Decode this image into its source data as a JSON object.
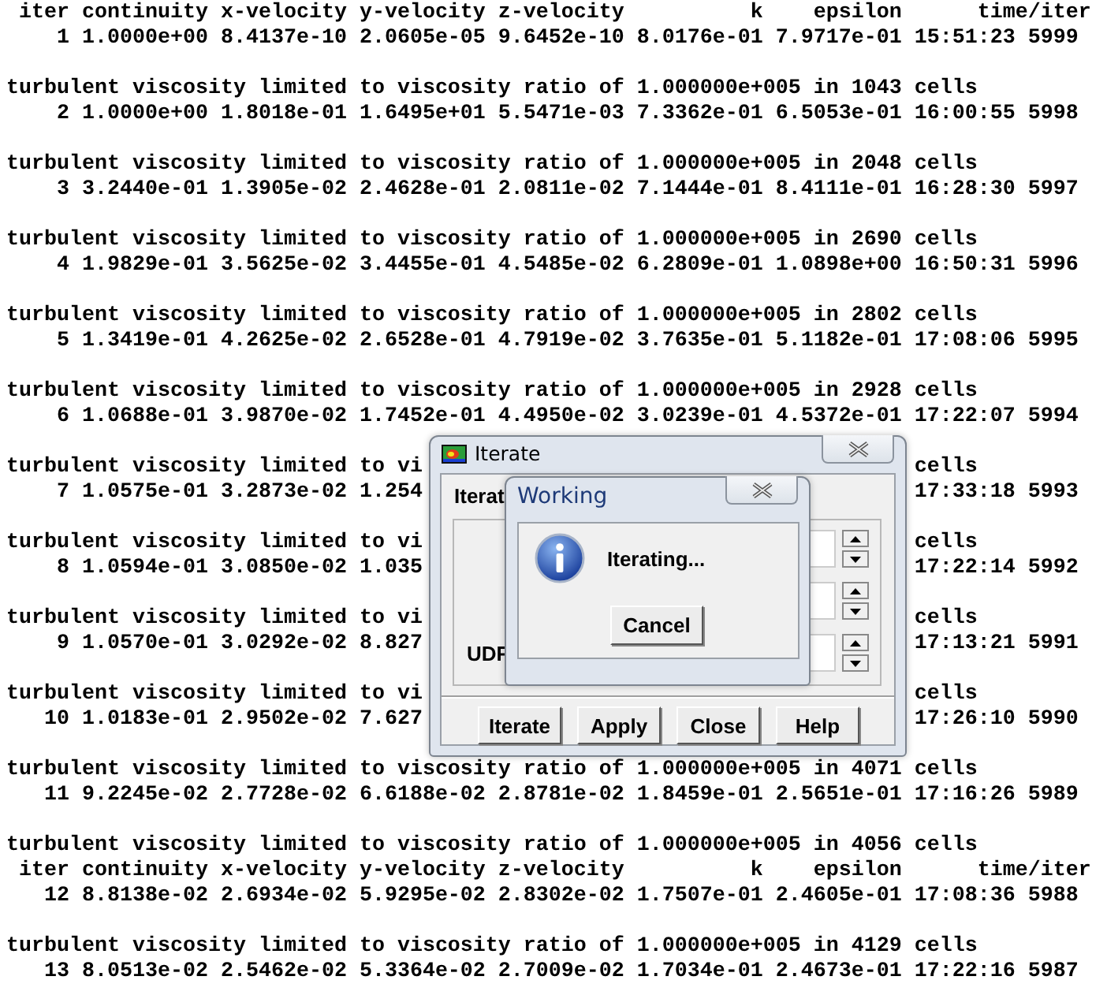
{
  "console": {
    "groups": [
      {
        "lines": [
          {
            "text": " iter continuity x-velocity y-velocity z-velocity          k    epsilon      time/iter"
          },
          {
            "text": "    1 1.0000e+00 8.4137e-10 2.0605e-05 9.6452e-10 8.0176e-01 7.9717e-01 15:51:23 5999"
          }
        ]
      },
      {
        "lines": [
          {
            "text": "turbulent viscosity limited to viscosity ratio of 1.000000e+005 in 1043 cells"
          },
          {
            "text": "    2 1.0000e+00 1.8018e-01 1.6495e+01 5.5471e-03 7.3362e-01 6.5053e-01 16:00:55 5998"
          }
        ]
      },
      {
        "lines": [
          {
            "text": "turbulent viscosity limited to viscosity ratio of 1.000000e+005 in 2048 cells"
          },
          {
            "text": "    3 3.2440e-01 1.3905e-02 2.4628e-01 2.0811e-02 7.1444e-01 8.4111e-01 16:28:30 5997"
          }
        ]
      },
      {
        "lines": [
          {
            "text": "turbulent viscosity limited to viscosity ratio of 1.000000e+005 in 2690 cells"
          },
          {
            "text": "    4 1.9829e-01 3.5625e-02 3.4455e-01 4.5485e-02 6.2809e-01 1.0898e+00 16:50:31 5996"
          }
        ]
      },
      {
        "lines": [
          {
            "text": "turbulent viscosity limited to viscosity ratio of 1.000000e+005 in 2802 cells"
          },
          {
            "text": "    5 1.3419e-01 4.2625e-02 2.6528e-01 4.7919e-02 3.7635e-01 5.1182e-01 17:08:06 5995"
          }
        ]
      },
      {
        "lines": [
          {
            "text": "turbulent viscosity limited to viscosity ratio of 1.000000e+005 in 2928 cells"
          },
          {
            "text": "    6 1.0688e-01 3.9870e-02 1.7452e-01 4.4950e-02 3.0239e-01 4.5372e-01 17:22:07 5994"
          }
        ]
      },
      {
        "lines": [
          {
            "left": "turbulent viscosity limited to vi",
            "right": "cells"
          },
          {
            "left": "    7 1.0575e-01 3.2873e-02 1.254",
            "right": "17:33:18 5993"
          }
        ]
      },
      {
        "lines": [
          {
            "left": "turbulent viscosity limited to vi",
            "right": "cells"
          },
          {
            "left": "    8 1.0594e-01 3.0850e-02 1.035",
            "right": "17:22:14 5992"
          }
        ]
      },
      {
        "lines": [
          {
            "left": "turbulent viscosity limited to vi",
            "right": "cells"
          },
          {
            "left": "    9 1.0570e-01 3.0292e-02 8.827",
            "right": "17:13:21 5991"
          }
        ]
      },
      {
        "lines": [
          {
            "left": "turbulent viscosity limited to vi",
            "right": "cells"
          },
          {
            "left": "   10 1.0183e-01 2.9502e-02 7.627",
            "right": "17:26:10 5990"
          }
        ]
      },
      {
        "lines": [
          {
            "text": "turbulent viscosity limited to viscosity ratio of 1.000000e+005 in 4071 cells"
          },
          {
            "text": "   11 9.2245e-02 2.7728e-02 6.6188e-02 2.8781e-02 1.8459e-01 2.5651e-01 17:16:26 5989"
          }
        ]
      },
      {
        "lines": [
          {
            "text": "turbulent viscosity limited to viscosity ratio of 1.000000e+005 in 4056 cells"
          },
          {
            "text": " iter continuity x-velocity y-velocity z-velocity          k    epsilon      time/iter"
          },
          {
            "text": "   12 8.8138e-02 2.6934e-02 5.9295e-02 2.8302e-02 1.7507e-01 2.4605e-01 17:08:36 5988"
          }
        ]
      },
      {
        "lines": [
          {
            "text": "turbulent viscosity limited to viscosity ratio of 1.000000e+005 in 4129 cells"
          },
          {
            "text": "   13 8.0513e-02 2.5462e-02 5.3364e-02 2.7009e-02 1.7034e-01 2.4673e-01 17:22:16 5987"
          }
        ]
      }
    ]
  },
  "iterate_dialog": {
    "title": "Iterate",
    "tab_label": "Iterat",
    "field_label": "UDF",
    "fields": [
      {
        "kind": "spinner"
      },
      {
        "kind": "spinner"
      },
      {
        "kind": "spinner"
      }
    ],
    "buttons": [
      "Iterate",
      "Apply",
      "Close",
      "Help"
    ]
  },
  "working_dialog": {
    "title": "Working",
    "message": "Iterating...",
    "button": "Cancel"
  }
}
